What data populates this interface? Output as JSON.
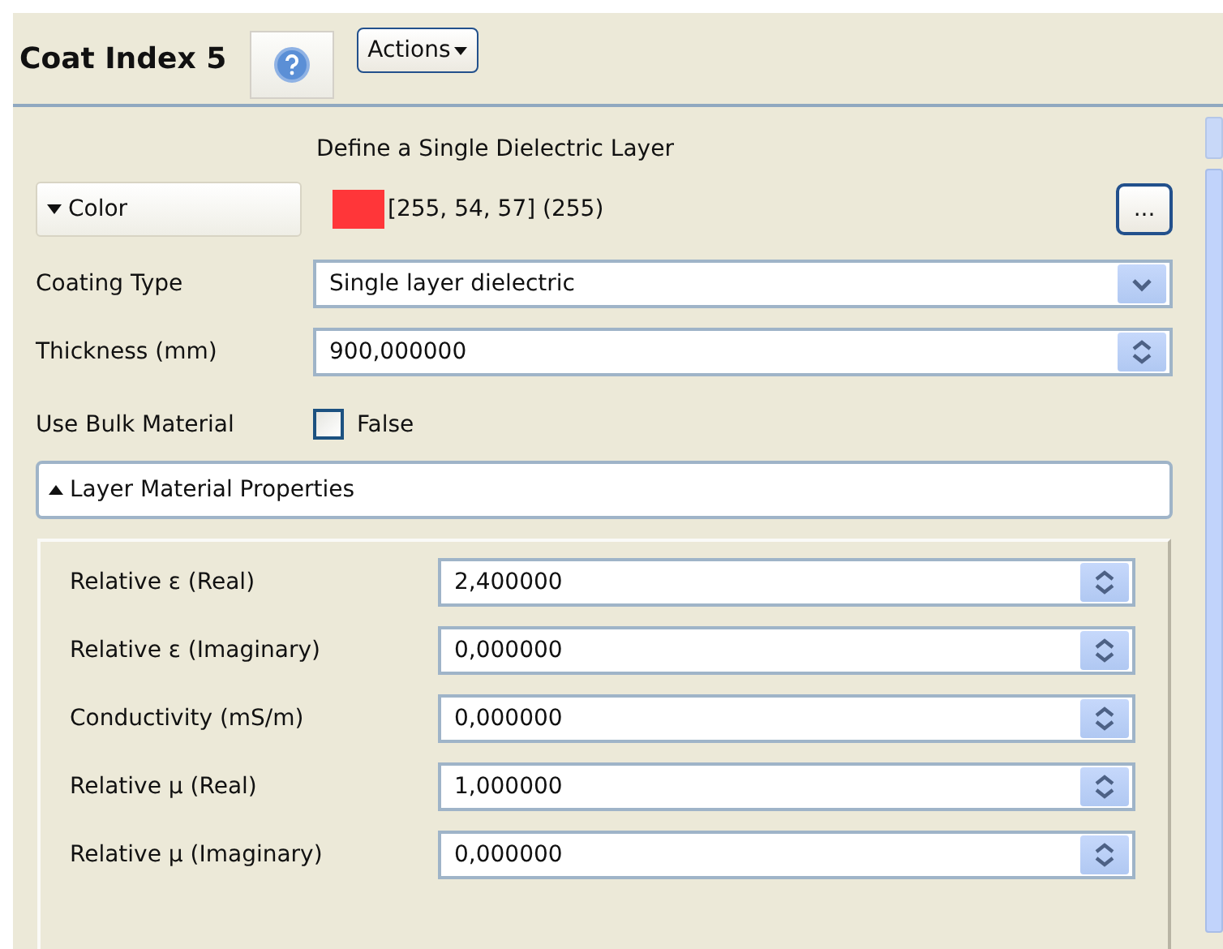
{
  "header": {
    "title": "Coat Index 5",
    "actions_button": "Actions"
  },
  "heading": "Define a Single Dielectric Layer",
  "color_section": {
    "label": "Color",
    "expanded": false,
    "value": "[255, 54, 57] (255)",
    "color": "#ff3639",
    "more_button": "..."
  },
  "fields": [
    {
      "kind": "dropdown",
      "label": "Coating Type",
      "value": "Single layer dielectric"
    },
    {
      "kind": "spinner",
      "label": "Thickness (mm)",
      "value": "900,000000"
    },
    {
      "kind": "checkbox",
      "label": "Use Bulk Material",
      "checked": false,
      "value": "False"
    }
  ],
  "material_section": {
    "label": "Layer Material Properties",
    "expanded": true,
    "fields": [
      {
        "label": "Relative ε (Real)",
        "value": "2,400000"
      },
      {
        "label": "Relative ε (Imaginary)",
        "value": "0,000000"
      },
      {
        "label": "Conductivity (mS/m)",
        "value": "0,000000"
      },
      {
        "label": "Relative µ (Real)",
        "value": "1,000000"
      },
      {
        "label": "Relative µ (Imaginary)",
        "value": "0,000000"
      }
    ]
  }
}
